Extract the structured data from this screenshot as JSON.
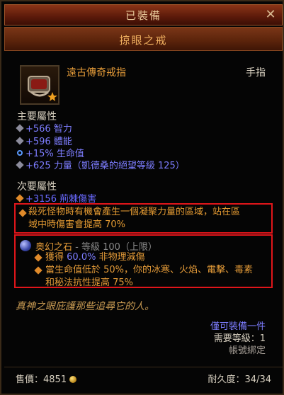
{
  "header": {
    "title": "已裝備",
    "close_icon": "close-icon"
  },
  "item": {
    "name": "掠眼之戒",
    "type": "遠古傳奇戒指",
    "slot": "手指",
    "icon": "ring-icon"
  },
  "primary": {
    "title": "主要屬性",
    "stats": [
      {
        "text": "+566 智力",
        "bullet": "diamond"
      },
      {
        "text": "+596 體能",
        "bullet": "diamond"
      },
      {
        "text": "+15% 生命值",
        "bullet": "ring"
      },
      {
        "text": "+625 力量（凱德桑的絕望等級 125）",
        "bullet": "diamond"
      }
    ]
  },
  "secondary": {
    "title": "次要屬性",
    "stats": [
      {
        "text": "+3156 荊棘傷害"
      }
    ]
  },
  "legendary_power": {
    "line1": "殺死怪物時有機會產生一個凝聚力量的區域，站在區",
    "line2": "域中時傷害會提高 70%"
  },
  "gem": {
    "name": "奧幻之石",
    "level": "- 等級 100（上限）",
    "effect1_prefix": "獲得 ",
    "effect1_value": "60.0%",
    "effect1_suffix": " 非物理減傷",
    "effect2_line1": "當生命值低於 50%，你的冰寒、火焰、電擊、毒素",
    "effect2_line2": "和秘法抗性提高 75%"
  },
  "flavor": "真神之眼庇護那些追尋它的人。",
  "info": {
    "equip_limit": "僅可裝備一件",
    "level_req": "需要等級：1",
    "account_bound": "帳號綁定"
  },
  "footer": {
    "sell_label": "售價：",
    "sell_value": "4851",
    "durability_label": "耐久度：",
    "durability_value": "34/34"
  },
  "colors": {
    "legendary": "#e39a38",
    "magic": "#7d7dff",
    "highlight_border": "#e0151a"
  }
}
